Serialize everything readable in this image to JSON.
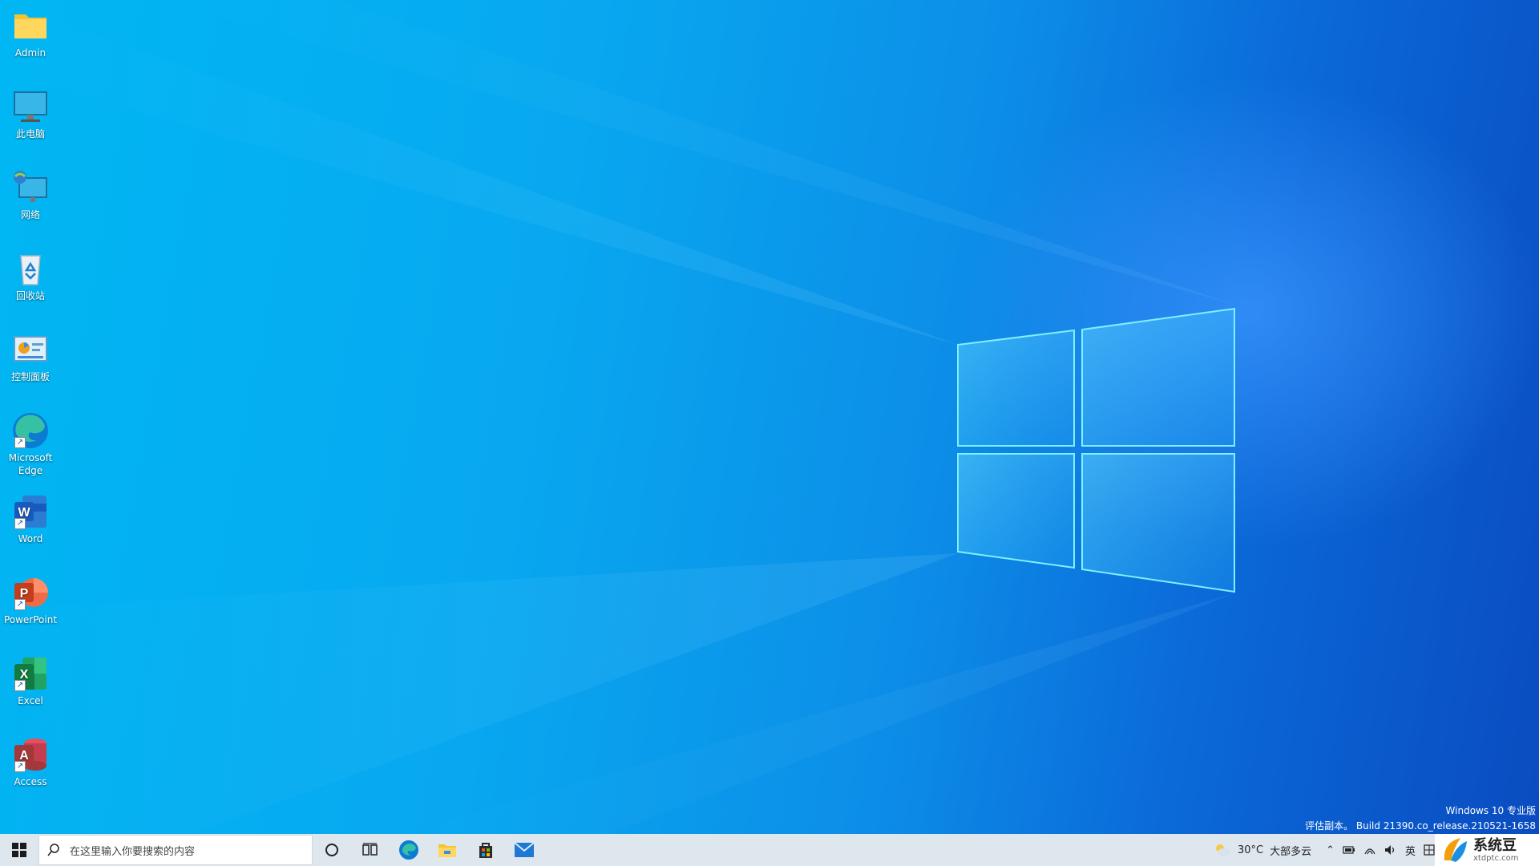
{
  "desktop": {
    "icons": [
      {
        "label": "Admin",
        "icon": "folder-icon"
      },
      {
        "label": "此电脑",
        "icon": "computer-icon"
      },
      {
        "label": "网络",
        "icon": "network-icon"
      },
      {
        "label": "回收站",
        "icon": "recycle-bin-icon"
      },
      {
        "label": "控制面板",
        "icon": "control-panel-icon"
      },
      {
        "label": "Microsoft Edge",
        "icon": "edge-icon"
      },
      {
        "label": "Word",
        "icon": "word-icon"
      },
      {
        "label": "PowerPoint",
        "icon": "powerpoint-icon"
      },
      {
        "label": "Excel",
        "icon": "excel-icon"
      },
      {
        "label": "Access",
        "icon": "access-icon"
      }
    ]
  },
  "watermark": {
    "line1": "Windows 10 专业版",
    "line2": "评估副本。 Build 21390.co_release.210521-1658"
  },
  "taskbar": {
    "search_placeholder": "在这里输入你要搜索的内容",
    "apps": [
      "cortana-icon",
      "task-view-icon",
      "edge-icon",
      "file-explorer-icon",
      "store-icon",
      "mail-icon"
    ],
    "weather_temp": "30°C",
    "weather_desc": "大部多云",
    "ime": "英"
  },
  "brand": {
    "name": "系统豆",
    "url": "xtdptc.com"
  },
  "colors": {
    "wallpaper_light": "#00b7f3",
    "wallpaper_dark": "#0a4cc0",
    "taskbar": "#dfe7ee"
  }
}
